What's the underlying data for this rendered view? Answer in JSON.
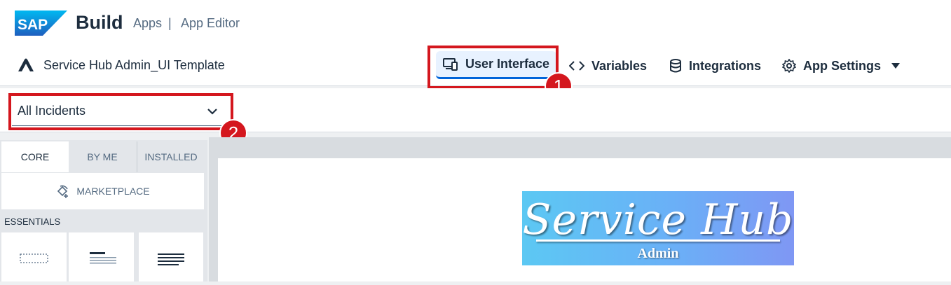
{
  "shell": {
    "logo_text": "SAP",
    "product": "Build",
    "breadcrumb": [
      "Apps",
      "|",
      "App Editor"
    ],
    "project_name": "Service Hub Admin_UI Template"
  },
  "nav": {
    "user_interface": "User Interface",
    "variables": "Variables",
    "integrations": "Integrations",
    "app_settings": "App Settings"
  },
  "annotations": {
    "badge1": "1",
    "badge2": "2",
    "highlight_color": "#d4171e"
  },
  "page_selector": {
    "value": "All Incidents"
  },
  "left_panel": {
    "tabs": [
      "CORE",
      "BY ME",
      "INSTALLED"
    ],
    "marketplace": "MARKETPLACE",
    "section": "ESSENTIALS",
    "components": [
      "container-icon",
      "title-text-icon",
      "paragraph-icon"
    ]
  },
  "canvas": {
    "hero_title": "Service Hub",
    "hero_subtitle": "Admin"
  },
  "colors": {
    "accent": "#0064d9",
    "sap_blue": "#0070f2"
  }
}
